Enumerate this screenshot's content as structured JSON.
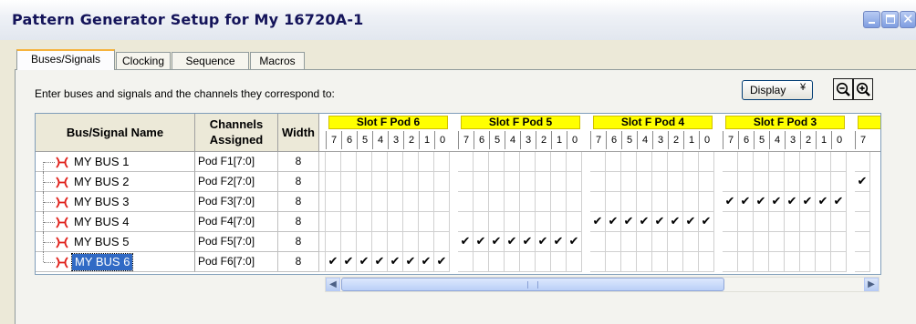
{
  "window": {
    "title": "Pattern Generator Setup for My 16720A-1"
  },
  "tabs": [
    {
      "label": "Buses/Signals",
      "active": true
    },
    {
      "label": "Clocking",
      "active": false
    },
    {
      "label": "Sequence",
      "active": false
    },
    {
      "label": "Macros",
      "active": false
    }
  ],
  "instruction": "Enter buses and signals and the channels they correspond to:",
  "toolbar": {
    "display_label": "Display",
    "zoom_out_icon": "zoom-out-icon",
    "zoom_in_icon": "zoom-in-icon"
  },
  "grid": {
    "headers": {
      "bus_signal_name": "Bus/Signal Name",
      "channels_line1": "Channels",
      "channels_line2": "Assigned",
      "width": "Width"
    },
    "pods": [
      "Slot F Pod 6",
      "Slot F Pod 5",
      "Slot F Pod 4",
      "Slot F Pod 3",
      ""
    ],
    "bits": [
      "7",
      "6",
      "5",
      "4",
      "3",
      "2",
      "1",
      "0"
    ],
    "partial_bit": "7",
    "check_glyph": "✔",
    "rows": [
      {
        "name": "MY BUS 1",
        "channels": "Pod F1[7:0]",
        "width": "8",
        "checked_pod": -1,
        "partial_check": false,
        "selected": false
      },
      {
        "name": "MY BUS 2",
        "channels": "Pod F2[7:0]",
        "width": "8",
        "checked_pod": -1,
        "partial_check": true,
        "selected": false
      },
      {
        "name": "MY BUS 3",
        "channels": "Pod F3[7:0]",
        "width": "8",
        "checked_pod": 3,
        "partial_check": false,
        "selected": false
      },
      {
        "name": "MY BUS 4",
        "channels": "Pod F4[7:0]",
        "width": "8",
        "checked_pod": 2,
        "partial_check": false,
        "selected": false
      },
      {
        "name": "MY BUS 5",
        "channels": "Pod F5[7:0]",
        "width": "8",
        "checked_pod": 1,
        "partial_check": false,
        "selected": false
      },
      {
        "name": "MY BUS 6",
        "channels": "Pod F6[7:0]",
        "width": "8",
        "checked_pod": 0,
        "partial_check": false,
        "selected": true
      }
    ],
    "bus_icon": "bus-icon"
  },
  "scrollbar": {
    "left_icon": "scroll-left-icon",
    "right_icon": "scroll-right-icon",
    "grip_icon": "grip-icon"
  },
  "colors": {
    "pod_header": "#ffff00",
    "selection": "#316ac5",
    "bus_icon": "#e0201a",
    "active_tab_accent": "#f6b33d"
  }
}
